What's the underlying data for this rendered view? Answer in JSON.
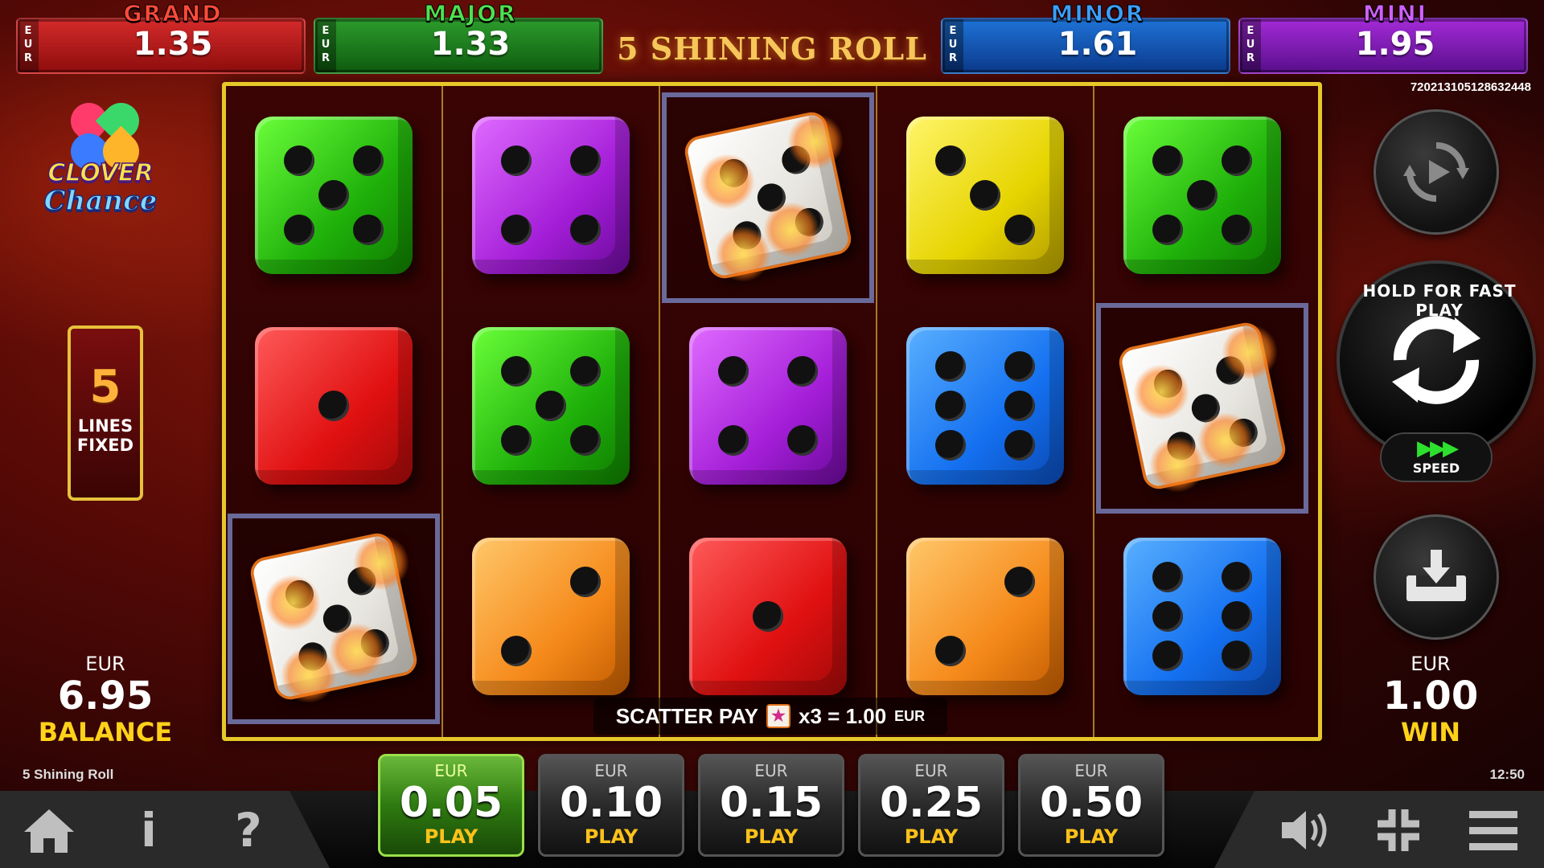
{
  "jackpots": {
    "grand": {
      "name": "GRAND",
      "currency": [
        "E",
        "U",
        "R"
      ],
      "value": "1.35"
    },
    "major": {
      "name": "MAJOR",
      "currency": [
        "E",
        "U",
        "R"
      ],
      "value": "1.33"
    },
    "minor": {
      "name": "MINOR",
      "currency": [
        "E",
        "U",
        "R"
      ],
      "value": "1.61"
    },
    "mini": {
      "name": "MINI",
      "currency": [
        "E",
        "U",
        "R"
      ],
      "value": "1.95"
    }
  },
  "game_title": "5 SHINING ROLL",
  "game_id": "720213105128632448",
  "logo": {
    "line1": "CLOVER",
    "line2": "Chance"
  },
  "lines": {
    "count": "5",
    "label1": "LINES",
    "label2": "FIXED"
  },
  "balance": {
    "currency": "EUR",
    "amount": "6.95",
    "label": "BALANCE"
  },
  "win": {
    "currency": "EUR",
    "amount": "1.00",
    "label": "WIN"
  },
  "scatter_pay": {
    "label": "SCATTER PAY",
    "multiplier": "x3 = 1.00",
    "currency": "EUR"
  },
  "reels": [
    [
      {
        "color": "green",
        "face": 5
      },
      {
        "color": "red",
        "face": 1
      },
      {
        "color": "white",
        "face": 5,
        "scatter": true
      }
    ],
    [
      {
        "color": "purple",
        "face": 4
      },
      {
        "color": "green",
        "face": 5
      },
      {
        "color": "orange",
        "face": 2
      }
    ],
    [
      {
        "color": "white",
        "face": 5,
        "scatter": true
      },
      {
        "color": "purple",
        "face": 4
      },
      {
        "color": "red",
        "face": 1
      }
    ],
    [
      {
        "color": "yellow",
        "face": 3
      },
      {
        "color": "blue",
        "face": 6
      },
      {
        "color": "orange",
        "face": 2
      }
    ],
    [
      {
        "color": "green",
        "face": 5
      },
      {
        "color": "white",
        "face": 5,
        "scatter": true
      },
      {
        "color": "blue",
        "face": 6
      }
    ]
  ],
  "spin_button": {
    "label": "HOLD FOR FAST PLAY"
  },
  "speed_button": {
    "label": "SPEED"
  },
  "footer": {
    "game_name": "5 Shining Roll",
    "clock": "12:50"
  },
  "bets": [
    {
      "currency": "EUR",
      "value": "0.05",
      "label": "PLAY",
      "active": true
    },
    {
      "currency": "EUR",
      "value": "0.10",
      "label": "PLAY",
      "active": false
    },
    {
      "currency": "EUR",
      "value": "0.15",
      "label": "PLAY",
      "active": false
    },
    {
      "currency": "EUR",
      "value": "0.25",
      "label": "PLAY",
      "active": false
    },
    {
      "currency": "EUR",
      "value": "0.50",
      "label": "PLAY",
      "active": false
    }
  ],
  "nav": {
    "info_glyph": "i",
    "help_glyph": "?"
  },
  "colors": {
    "grand": "#d42a2a",
    "major": "#2c9b2c",
    "minor": "#1e72d6",
    "mini": "#a32ad6",
    "reel_frame": "#e6c82a",
    "win_label": "#ffd21a",
    "play_label": "#ffc21a"
  },
  "icons": {
    "home": "home-icon",
    "info": "info-icon",
    "help": "help-icon",
    "sound": "speaker-icon",
    "fullscreen": "fullscreen-icon",
    "menu": "menu-icon",
    "autoplay": "autoplay-icon",
    "spin": "spin-icon",
    "collect": "collect-icon"
  }
}
